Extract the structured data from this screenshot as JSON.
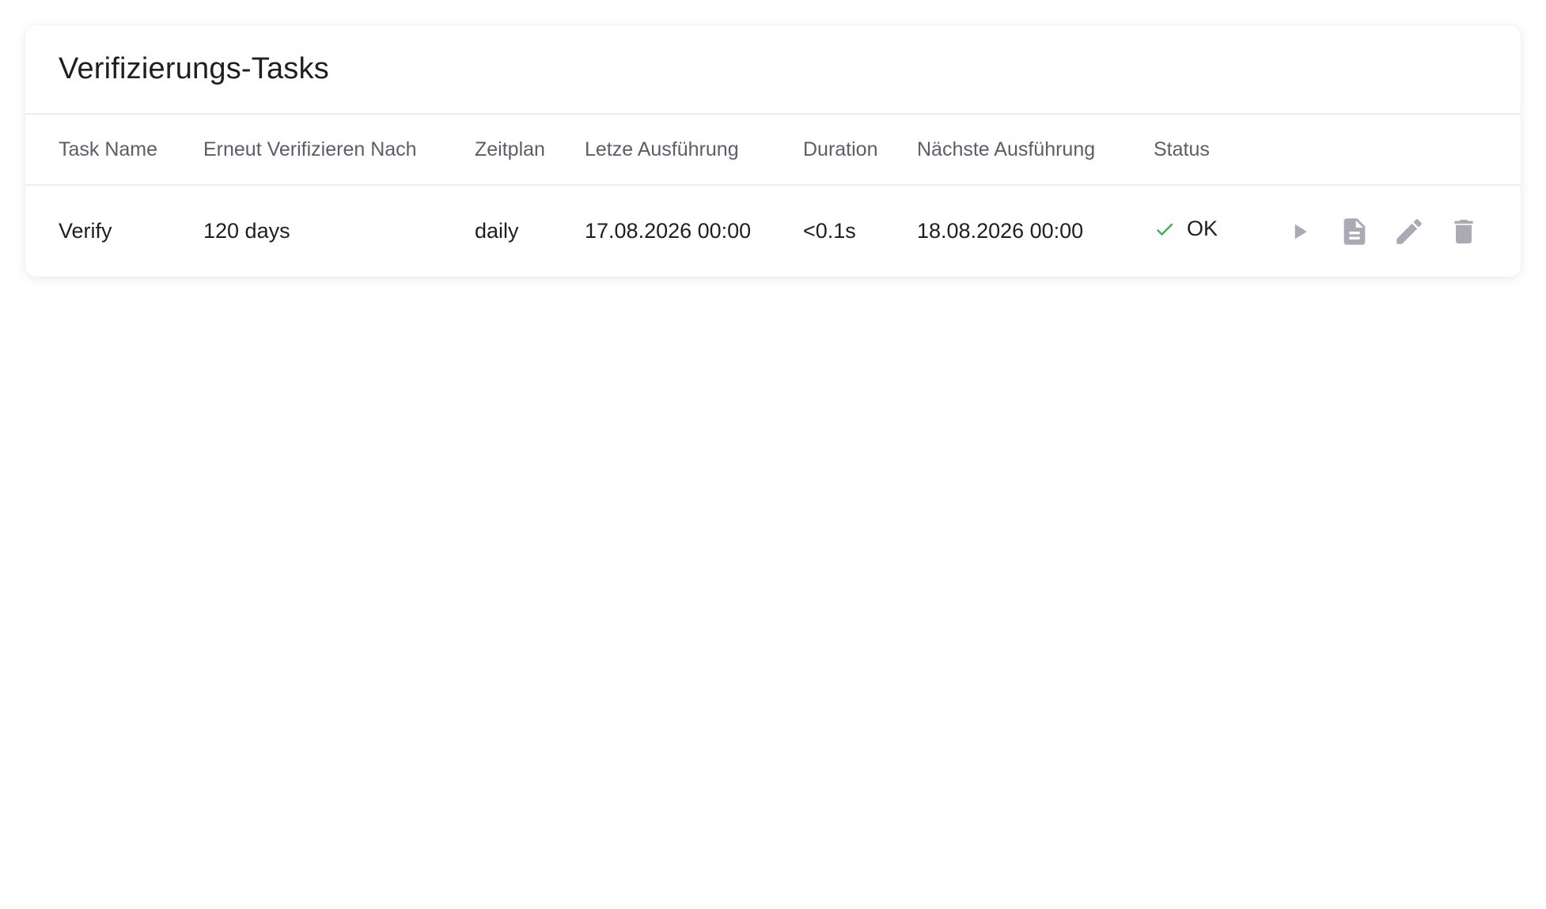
{
  "panel": {
    "title": "Verifizierungs-Tasks"
  },
  "table": {
    "columns": [
      "Task Name",
      "Erneut Verifizieren Nach",
      "Zeitplan",
      "Letze Ausführung",
      "Duration",
      "Nächste Ausführung",
      "Status"
    ],
    "rows": [
      {
        "task_name": "Verify",
        "reverify_after": "120 days",
        "schedule": "daily",
        "last_run": "17.08.2026 00:00",
        "duration": "<0.1s",
        "next_run": "18.08.2026 00:00",
        "status": "OK",
        "status_icon": "check-icon",
        "actions": [
          "play-icon",
          "document-icon",
          "pencil-icon",
          "trash-icon"
        ]
      }
    ]
  },
  "colors": {
    "status_ok": "#2fb34a",
    "action_icon": "#a9aab3",
    "header_text": "#5c5d6b",
    "body_text": "#1f1f23"
  }
}
